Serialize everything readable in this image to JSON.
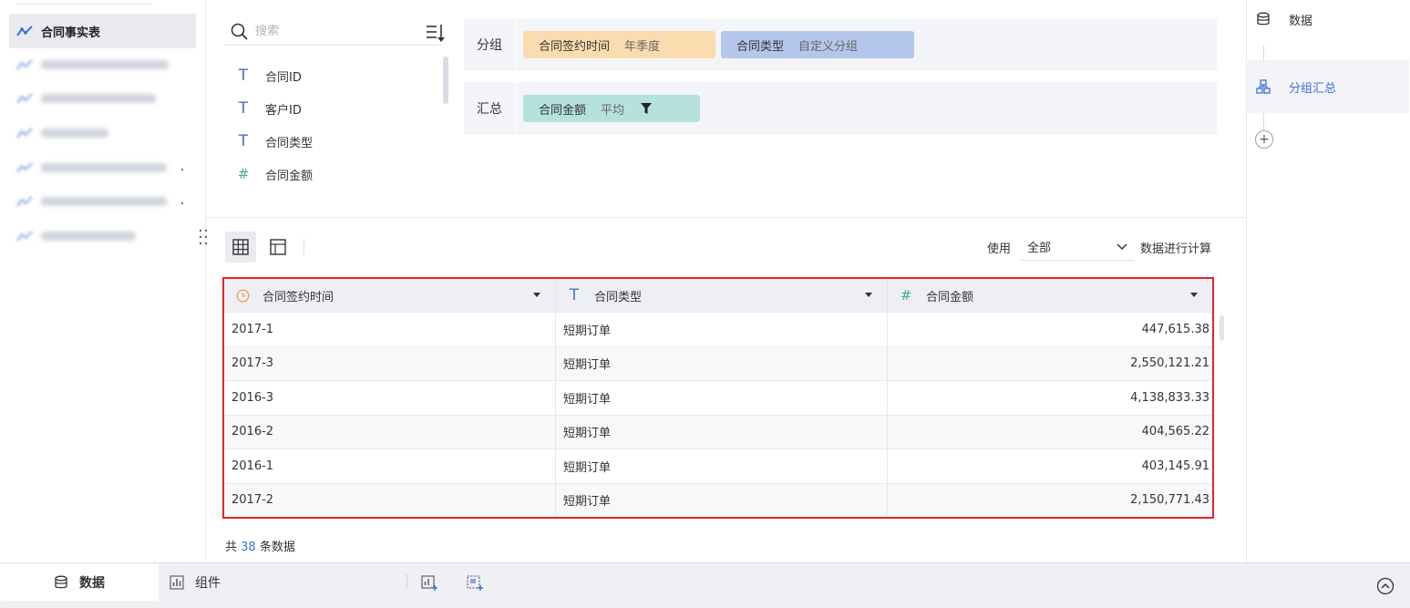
{
  "left_sidebar": {
    "active_table": "合同事实表",
    "blurred_item_count": 6
  },
  "fields_panel": {
    "search_placeholder": "搜索",
    "fields": [
      {
        "type_icon": "T",
        "label": "合同ID"
      },
      {
        "type_icon": "T",
        "label": "客户ID"
      },
      {
        "type_icon": "T",
        "label": "合同类型"
      },
      {
        "type_icon": "#",
        "label": "合同金额"
      }
    ]
  },
  "config": {
    "group_label": "分组",
    "group_chips": [
      {
        "name": "合同签约时间",
        "sub": "年季度",
        "color": "#fbdcae"
      },
      {
        "name": "合同类型",
        "sub": "自定义分组",
        "color": "#b4c6ec"
      }
    ],
    "summary_label": "汇总",
    "summary_chips": [
      {
        "name": "合同金额",
        "sub": "平均",
        "color": "#b5e2dc"
      }
    ]
  },
  "toolbar": {
    "use_label": "使用",
    "use_value": "全部",
    "calc_label": "数据进行计算"
  },
  "table": {
    "columns": [
      {
        "label": "合同签约时间",
        "icon": "clock-icon",
        "icon_color": "#f5a05a"
      },
      {
        "label": "合同类型",
        "icon": "text-type-icon",
        "icon_color": "#4a6fd8"
      },
      {
        "label": "合同金额",
        "icon": "number-type-icon",
        "icon_color": "#3fb19b"
      }
    ],
    "rows": [
      [
        "2017-1",
        "短期订单",
        "447,615.38"
      ],
      [
        "2017-3",
        "短期订单",
        "2,550,121.21"
      ],
      [
        "2016-3",
        "短期订单",
        "4,138,833.33"
      ],
      [
        "2016-2",
        "短期订单",
        "404,565.22"
      ],
      [
        "2016-1",
        "短期订单",
        "403,145.91"
      ],
      [
        "2017-2",
        "短期订单",
        "2,150,771.43"
      ]
    ],
    "total_prefix": "共",
    "total_count": "38",
    "total_suffix": "条数据"
  },
  "right_panel": {
    "steps": [
      {
        "label": "数据",
        "icon": "database-icon"
      },
      {
        "label": "分组汇总",
        "icon": "group-summary-icon"
      }
    ],
    "add_symbol": "+"
  },
  "bottom_bar": {
    "tabs": [
      {
        "label": "数据",
        "icon": "database-icon"
      },
      {
        "label": "组件",
        "icon": "bar-chart-icon"
      }
    ]
  },
  "colors": {
    "accent": "#3a6fd8",
    "highlight_border": "#e5252a"
  }
}
